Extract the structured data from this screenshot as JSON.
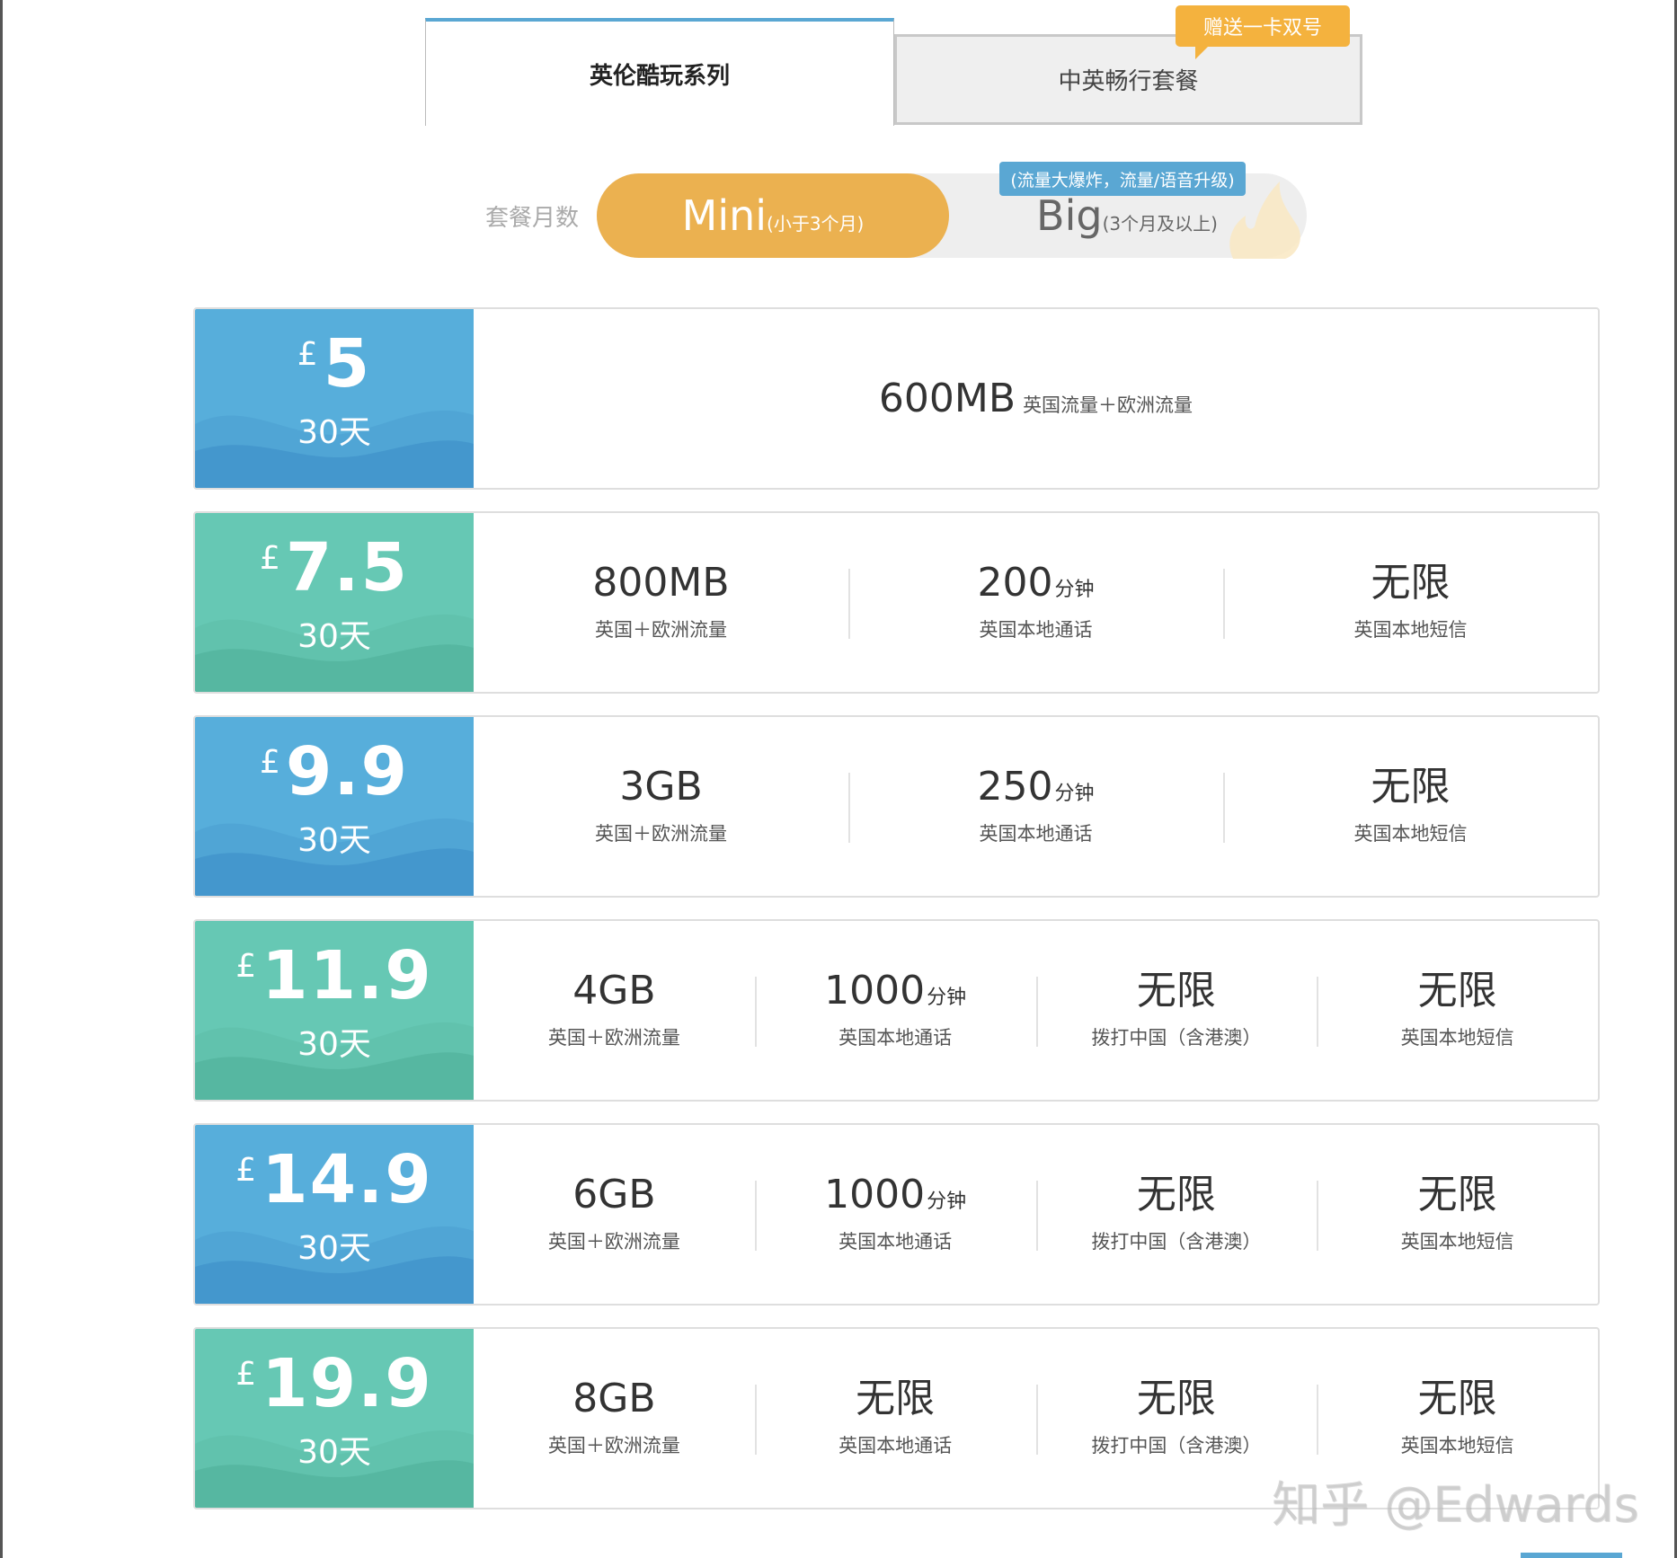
{
  "series_tabs": {
    "active": "英伦酷玩系列",
    "inactive": "中英畅行套餐",
    "gift_badge": "赠送一卡双号"
  },
  "duration": {
    "label": "套餐月数",
    "mini": {
      "main": "Mini",
      "sub": "(小于3个月)",
      "selected": true
    },
    "big": {
      "main": "Big",
      "sub": "(3个月及以上)",
      "badge": "(流量大爆炸，流量/语音升级)",
      "selected": false
    }
  },
  "colors": {
    "blue": "#57aedb",
    "teal": "#66c8b4",
    "orange": "#ebb150",
    "accent_blue": "#5aa7d3"
  },
  "plans": [
    {
      "theme": "blue",
      "currency": "£",
      "price": "5",
      "period": "30天",
      "features": [
        {
          "value": "600MB",
          "unit": "",
          "label": "英国流量＋欧洲流量"
        }
      ]
    },
    {
      "theme": "teal",
      "currency": "£",
      "price": "7.5",
      "period": "30天",
      "features": [
        {
          "value": "800MB",
          "unit": "",
          "label": "英国＋欧洲流量"
        },
        {
          "value": "200",
          "unit": "分钟",
          "label": "英国本地通话"
        },
        {
          "value": "无限",
          "unit": "",
          "label": "英国本地短信"
        }
      ]
    },
    {
      "theme": "blue",
      "currency": "£",
      "price": "9.9",
      "period": "30天",
      "features": [
        {
          "value": "3GB",
          "unit": "",
          "label": "英国＋欧洲流量"
        },
        {
          "value": "250",
          "unit": "分钟",
          "label": "英国本地通话"
        },
        {
          "value": "无限",
          "unit": "",
          "label": "英国本地短信"
        }
      ]
    },
    {
      "theme": "teal",
      "currency": "£",
      "price": "11.9",
      "period": "30天",
      "features": [
        {
          "value": "4GB",
          "unit": "",
          "label": "英国＋欧洲流量"
        },
        {
          "value": "1000",
          "unit": "分钟",
          "label": "英国本地通话"
        },
        {
          "value": "无限",
          "unit": "",
          "label": "拨打中国（含港澳）"
        },
        {
          "value": "无限",
          "unit": "",
          "label": "英国本地短信"
        }
      ]
    },
    {
      "theme": "blue",
      "currency": "£",
      "price": "14.9",
      "period": "30天",
      "features": [
        {
          "value": "6GB",
          "unit": "",
          "label": "英国＋欧洲流量"
        },
        {
          "value": "1000",
          "unit": "分钟",
          "label": "英国本地通话"
        },
        {
          "value": "无限",
          "unit": "",
          "label": "拨打中国（含港澳）"
        },
        {
          "value": "无限",
          "unit": "",
          "label": "英国本地短信"
        }
      ]
    },
    {
      "theme": "teal",
      "currency": "£",
      "price": "19.9",
      "period": "30天",
      "features": [
        {
          "value": "8GB",
          "unit": "",
          "label": "英国＋欧洲流量"
        },
        {
          "value": "无限",
          "unit": "",
          "label": "英国本地通话"
        },
        {
          "value": "无限",
          "unit": "",
          "label": "拨打中国（含港澳）"
        },
        {
          "value": "无限",
          "unit": "",
          "label": "英国本地短信"
        }
      ]
    }
  ],
  "watermark": "知乎 @Edwards"
}
